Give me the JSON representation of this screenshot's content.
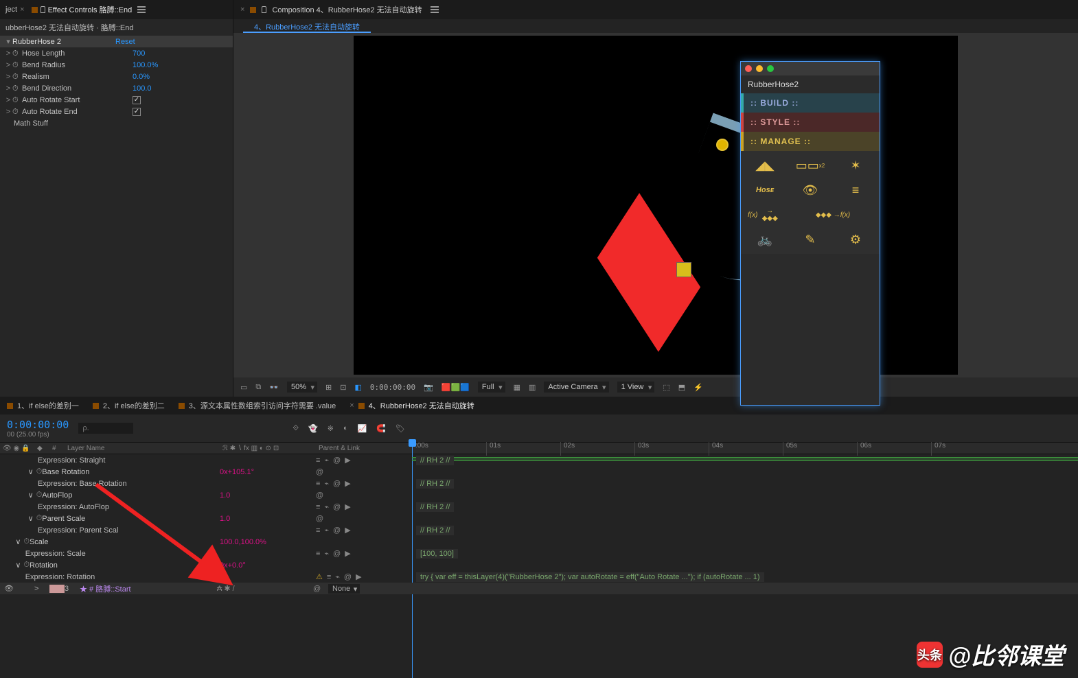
{
  "fx_panel": {
    "tab_project": "ject",
    "tab_fx": "Effect Controls 胳膊::End",
    "subtitle": "ubberHose2 无法自动旋转 · 胳膊::End",
    "effect": {
      "name": "RubberHose 2",
      "reset": "Reset",
      "props": [
        {
          "label": "Hose Length",
          "value": "700"
        },
        {
          "label": "Bend Radius",
          "value": "100.0%"
        },
        {
          "label": "Realism",
          "value": "0.0%"
        },
        {
          "label": "Bend Direction",
          "value": "100.0"
        },
        {
          "label": "Auto Rotate Start",
          "checkbox": true,
          "checked": true
        },
        {
          "label": "Auto Rotate End",
          "checkbox": true,
          "checked": true
        },
        {
          "label": "Math Stuff",
          "plain": true
        }
      ]
    }
  },
  "comp_panel": {
    "tab": "Composition 4、RubberHose2 无法自动旋转",
    "crumb": "4、RubberHose2 无法自动旋转"
  },
  "viewer_bar": {
    "zoom": "50%",
    "time": "0:00:00:00",
    "quality": "Full",
    "camera": "Active Camera",
    "views": "1 View"
  },
  "plugin": {
    "title": "RubberHose2",
    "sections": {
      "build": ":: BUILD ::",
      "style": ":: STYLE ::",
      "manage": ":: MANAGE ::"
    },
    "traffic": {
      "r": "#ff5f57",
      "y": "#febc2e",
      "g": "#28c840"
    },
    "icons": [
      "hose-curve",
      "width-x2",
      "bend-center",
      "hose-label",
      "eye",
      "list",
      "fx-to-keys",
      "keys-to-fx",
      "walk-cycle",
      "guide",
      "shape-fix",
      "bug",
      "gear"
    ]
  },
  "tl_tabs": [
    {
      "label": "1、if else的差别一"
    },
    {
      "label": "2、if else的差别二"
    },
    {
      "label": "3、源文本属性数组索引访问字符需要 .value"
    },
    {
      "label": "4、RubberHose2 无法自动旋转",
      "active": true
    }
  ],
  "timecode": "0:00:00:00",
  "fps": "00 (25.00 fps)",
  "search_ph": "ρ.",
  "col": {
    "num": "#",
    "layer": "Layer Name",
    "parent": "Parent & Link"
  },
  "ruler": [
    ":00s",
    "01s",
    "02s",
    "03s",
    "04s",
    "05s",
    "06s",
    "07s"
  ],
  "rows": [
    {
      "indent": 3,
      "label": "Expression: Straight",
      "sw": "expr",
      "tag": "// RH 2 //"
    },
    {
      "indent": 2,
      "chev": "∨",
      "stopwatch": true,
      "label": "Base Rotation",
      "val": "0x+105.1°",
      "swsw": true
    },
    {
      "indent": 3,
      "label": "Expression: Base Rotation",
      "sw": "expr",
      "tag": "// RH 2 //"
    },
    {
      "indent": 2,
      "chev": "∨",
      "stopwatch": true,
      "label": "AutoFlop",
      "val": "1.0",
      "swsw": true
    },
    {
      "indent": 3,
      "label": "Expression: AutoFlop",
      "sw": "expr",
      "tag": "// RH 2 //"
    },
    {
      "indent": 2,
      "chev": "∨",
      "stopwatch": true,
      "label": "Parent Scale",
      "val": "1.0",
      "swsw": true
    },
    {
      "indent": 3,
      "label": "Expression: Parent Scal",
      "sw": "expr",
      "tag": "// RH 2 //"
    },
    {
      "indent": 1,
      "chev": "∨",
      "stopwatch": true,
      "label": "Scale",
      "val": "100.0,100.0%"
    },
    {
      "indent": 2,
      "label": "Expression: Scale",
      "sw": "expr",
      "tag": "[100, 100]"
    },
    {
      "indent": 1,
      "chev": "∨",
      "stopwatch": true,
      "label": "Rotation",
      "val": "0x+0.0°"
    },
    {
      "indent": 2,
      "label": "Expression: Rotation",
      "sw": "expr_warn",
      "tag": "try { var eff = thisLayer(4)(\"RubberHose 2\"); var autoRotate = eff(\"Auto Rotate ...\"); if (autoRotate ... 1)"
    }
  ],
  "last_layer": {
    "num": "3",
    "name": "胳膊::Start",
    "parent": "None"
  },
  "watermark": {
    "prefix": "头条",
    "brand": "@比邻课堂"
  }
}
